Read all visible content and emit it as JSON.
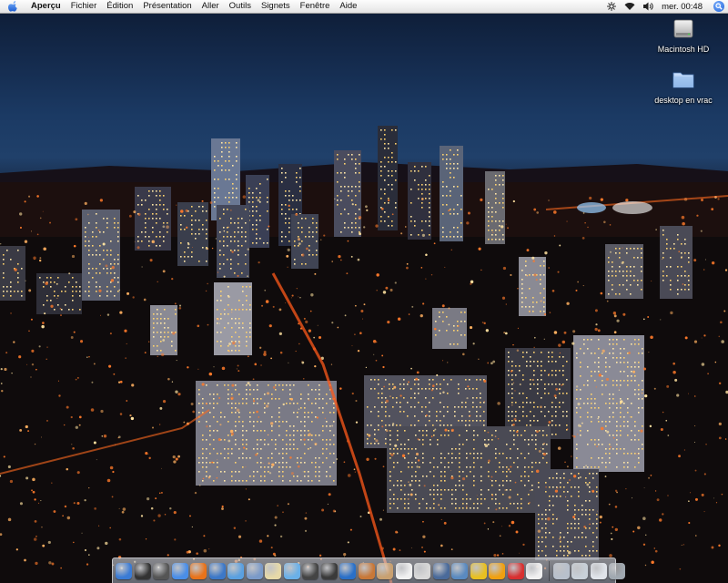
{
  "menubar": {
    "apple_icon": "apple-icon",
    "app_name": "Aperçu",
    "menus": [
      "Fichier",
      "Édition",
      "Présentation",
      "Aller",
      "Outils",
      "Signets",
      "Fenêtre",
      "Aide"
    ],
    "status_icons": [
      "sync-icon",
      "wifi-icon",
      "volume-icon"
    ],
    "clock": "mer. 00:48",
    "spotlight_icon": "spotlight-search-icon"
  },
  "desktop": {
    "icons": [
      {
        "label": "Macintosh HD",
        "icon": "hard-drive-icon"
      },
      {
        "label": "desktop en vrac",
        "icon": "folder-icon"
      }
    ]
  },
  "dock": {
    "items": [
      {
        "icon": "finder-icon",
        "color": "#3a7bd5"
      },
      {
        "icon": "dashboard-icon",
        "color": "#333333"
      },
      {
        "icon": "bittorrent-icon",
        "color": "#555555"
      },
      {
        "icon": "safari-icon",
        "color": "#4a8ee8"
      },
      {
        "icon": "firefox-icon",
        "color": "#e8731a"
      },
      {
        "icon": "network-icon",
        "color": "#3c78c8"
      },
      {
        "icon": "ichat-icon",
        "color": "#5aa0e0"
      },
      {
        "icon": "preview-icon",
        "color": "#7a9ac8"
      },
      {
        "icon": "textedit-icon",
        "color": "#e6d9a8"
      },
      {
        "icon": "itunes-icon",
        "color": "#6ab0e8"
      },
      {
        "icon": "movie-icon",
        "color": "#444444"
      },
      {
        "icon": "clapper-icon",
        "color": "#3a3a3a"
      },
      {
        "icon": "globe-icon",
        "color": "#2a70c8"
      },
      {
        "icon": "paintbrush-icon",
        "color": "#c87838"
      },
      {
        "icon": "photo-icon",
        "color": "#c8a070"
      },
      {
        "icon": "calendar-icon",
        "color": "#f0f0f0"
      },
      {
        "icon": "mail-icon",
        "color": "#d8d8d8"
      },
      {
        "icon": "console-icon",
        "color": "#4a6a9a"
      },
      {
        "icon": "mail-stamp-icon",
        "color": "#5a8ac0"
      },
      {
        "icon": "banana-icon",
        "color": "#e8c020"
      },
      {
        "icon": "ring-icon",
        "color": "#f0a010"
      },
      {
        "icon": "lifebuoy-icon",
        "color": "#d83030"
      },
      {
        "icon": "package-icon",
        "color": "#f0f0f0"
      }
    ],
    "right_items": [
      {
        "icon": "pen-icon",
        "color": "#b8c0cc"
      },
      {
        "icon": "magnifier-icon",
        "color": "#c8d0d8"
      },
      {
        "icon": "document-icon",
        "color": "#e0e4ea"
      },
      {
        "icon": "trash-icon",
        "color": "#a0a8b0"
      }
    ]
  }
}
